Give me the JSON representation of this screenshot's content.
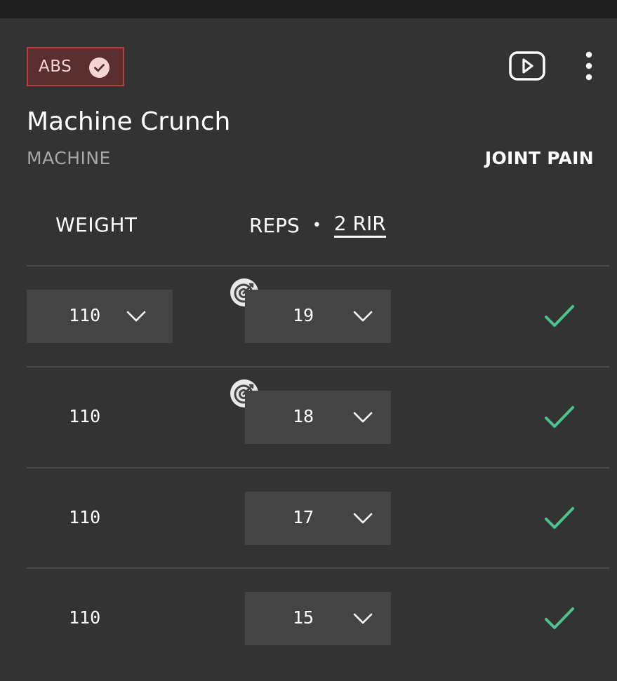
{
  "header": {
    "tag_label": "ABS",
    "tag_icon": "check-circle-icon",
    "tag_bg_color": "#5a2f2f",
    "tag_border_color": "#c23b3b",
    "video_icon": "play-video-icon",
    "menu_icon": "more-vertical-icon"
  },
  "exercise": {
    "title": "Machine Crunch",
    "equipment": "MACHINE",
    "joint_pain_label": "JOINT PAIN"
  },
  "columns": {
    "weight_label": "WEIGHT",
    "reps_label": "REPS",
    "separator": "•",
    "rir_label": "2 RIR"
  },
  "sets": [
    {
      "weight": "110",
      "reps": "19",
      "weight_dropdown": true,
      "target_icon": true,
      "completed": true
    },
    {
      "weight": "110",
      "reps": "18",
      "weight_dropdown": false,
      "target_icon": true,
      "completed": true
    },
    {
      "weight": "110",
      "reps": "17",
      "weight_dropdown": false,
      "target_icon": false,
      "completed": true
    },
    {
      "weight": "110",
      "reps": "15",
      "weight_dropdown": false,
      "target_icon": false,
      "completed": true
    }
  ],
  "colors": {
    "background": "#333333",
    "field_background": "#444444",
    "check_color": "#4ec48c"
  }
}
